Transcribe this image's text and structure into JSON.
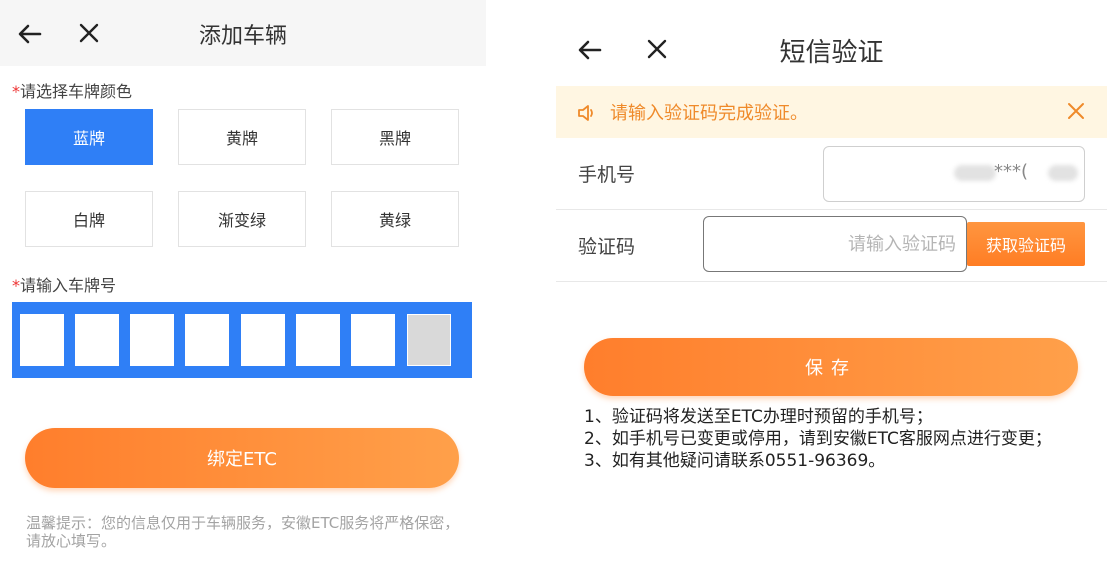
{
  "left": {
    "header": {
      "title": "添加车辆"
    },
    "color_section": {
      "required_mark": "*",
      "label": "请选择车牌颜色",
      "options": [
        {
          "label": "蓝牌",
          "selected": true
        },
        {
          "label": "黄牌",
          "selected": false
        },
        {
          "label": "黑牌",
          "selected": false
        },
        {
          "label": "白牌",
          "selected": false
        },
        {
          "label": "渐变绿",
          "selected": false
        },
        {
          "label": "黄绿",
          "selected": false
        }
      ]
    },
    "plate_section": {
      "required_mark": "*",
      "label": "请输入车牌号",
      "cell_count": 8
    },
    "bind_button": "绑定ETC",
    "tip": "温馨提示：您的信息仅用于车辆服务，安徽ETC服务将严格保密，请放心填写。"
  },
  "right": {
    "header": {
      "title": "短信验证"
    },
    "notice": {
      "text": "请输入验证码完成验证。"
    },
    "phone": {
      "label": "手机号",
      "value": "***("
    },
    "code": {
      "label": "验证码",
      "placeholder": "请输入验证码",
      "button": "获取验证码"
    },
    "save_button": "保存",
    "notes": [
      "1、验证码将发送至ETC办理时预留的手机号；",
      "2、如手机号已变更或停用，请到安徽ETC客服网点进行变更；",
      "3、如有其他疑问请联系0551-96369。"
    ]
  },
  "colors": {
    "blue": "#2f7ff6",
    "orange": "#ff8a34",
    "notice_bg": "#fff6e2",
    "notice_text": "#ef8a2a"
  },
  "icons": [
    "back-arrow-icon",
    "close-icon",
    "speaker-icon"
  ]
}
